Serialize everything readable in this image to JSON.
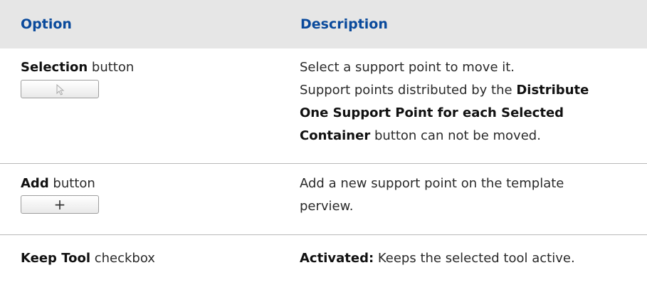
{
  "table": {
    "headers": {
      "option": "Option",
      "description": "Description"
    },
    "rows": [
      {
        "option_bold": "Selection",
        "option_rest": " button",
        "control": "arrow-icon",
        "description_lines": [
          {
            "text": "Select a support point to move it."
          },
          {
            "pre": "Support points distributed by the ",
            "bold": "Distribute"
          },
          {
            "bold": "One Support Point for each Selected"
          },
          {
            "bold": "Container",
            "post": " button can not be moved."
          }
        ]
      },
      {
        "option_bold": "Add",
        "option_rest": " button",
        "control": "plus-icon",
        "control_label": "+",
        "description_lines": [
          {
            "text": "Add a new support point on the template"
          },
          {
            "text": "perview."
          }
        ]
      },
      {
        "option_bold": "Keep Tool",
        "option_rest": " checkbox",
        "description_lines": [
          {
            "bold": "Activated:",
            "post": " Keeps the selected tool active."
          }
        ]
      }
    ]
  },
  "colors": {
    "header_text": "#0a4a9c",
    "header_bg": "#e6e6e6",
    "divider": "#b9b9b9"
  }
}
